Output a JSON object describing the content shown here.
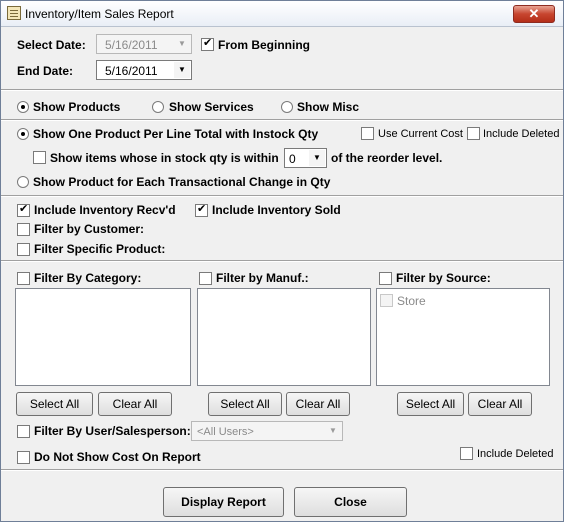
{
  "window": {
    "title": "Inventory/Item Sales Report",
    "close_glyph": "✕"
  },
  "dates": {
    "select_date_label": "Select Date:",
    "select_date_value": "5/16/2011",
    "from_beginning_label": "From Beginning",
    "from_beginning_checked": true,
    "end_date_label": "End Date:",
    "end_date_value": "5/16/2011"
  },
  "show_type": {
    "products_label": "Show Products",
    "services_label": "Show Services",
    "misc_label": "Show Misc",
    "selected": "products"
  },
  "line_mode": {
    "one_per_line_label": "Show One Product Per Line Total with Instock Qty",
    "use_current_cost_label": "Use Current Cost",
    "include_deleted_label": "Include Deleted",
    "within_label": "Show items whose in stock qty is within",
    "within_value": "0",
    "reorder_label": "of the reorder level.",
    "each_change_label": "Show Product for Each Transactional Change in Qty",
    "selected": "one_per_line"
  },
  "filters": {
    "include_recvd_label": "Include Inventory Recv'd",
    "include_sold_label": "Include Inventory Sold",
    "by_customer_label": "Filter by Customer:",
    "specific_product_label": "Filter Specific Product:"
  },
  "lists": {
    "category_label": "Filter By Category:",
    "manuf_label": "Filter by Manuf.:",
    "source_label": "Filter by Source:",
    "source_items": [
      "Store"
    ],
    "select_all_label": "Select All",
    "clear_all_label": "Clear All"
  },
  "user_filter": {
    "label": "Filter By User/Salesperson:",
    "placeholder": "<All Users>",
    "no_cost_label": "Do Not Show Cost On Report",
    "include_deleted_label": "Include Deleted"
  },
  "actions": {
    "display_label": "Display Report",
    "close_label": "Close"
  }
}
